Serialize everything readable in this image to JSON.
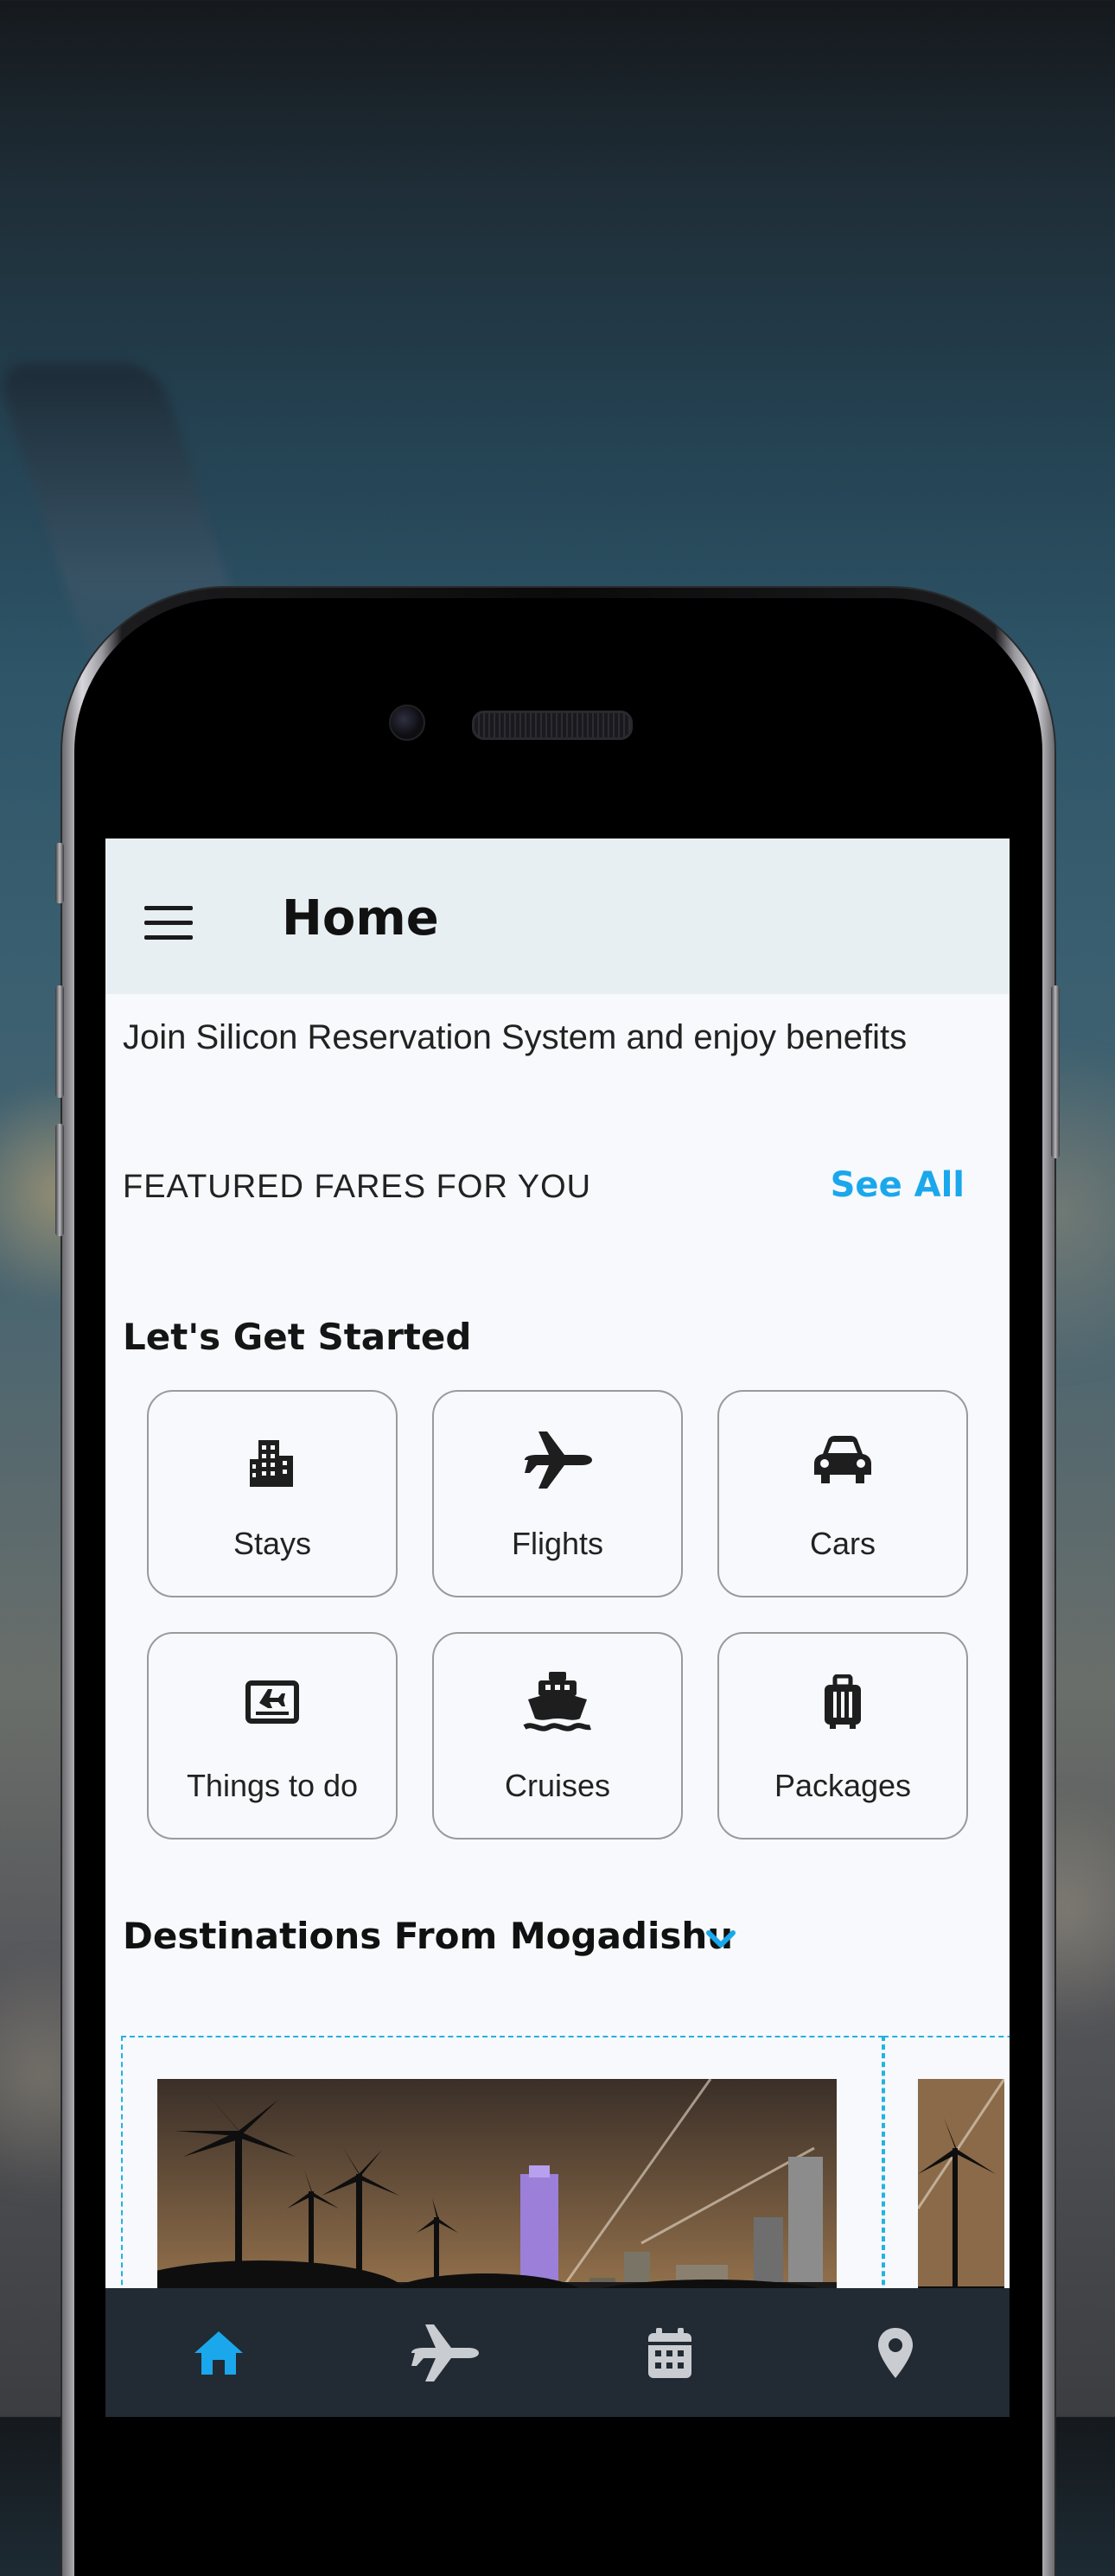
{
  "app": {
    "title": "Home"
  },
  "promo": {
    "text": "Join Silicon Reservation System and enjoy benefits"
  },
  "featured": {
    "title": "FEATURED FARES FOR YOU",
    "see_all": "See All"
  },
  "get_started": {
    "title": "Let's Get Started",
    "tiles": [
      {
        "label": "Stays",
        "icon": "building-icon"
      },
      {
        "label": "Flights",
        "icon": "airplane-icon"
      },
      {
        "label": "Cars",
        "icon": "car-icon"
      },
      {
        "label": "Things to do",
        "icon": "ticket-icon"
      },
      {
        "label": "Cruises",
        "icon": "ship-icon"
      },
      {
        "label": "Packages",
        "icon": "luggage-icon"
      }
    ]
  },
  "destinations": {
    "title": "Destinations From Mogadishu",
    "accent_color": "#1aa7ec"
  },
  "bottom_nav": {
    "items": [
      {
        "icon": "home-icon",
        "active": true
      },
      {
        "icon": "airplane-icon",
        "active": false
      },
      {
        "icon": "calendar-icon",
        "active": false
      },
      {
        "icon": "location-pin-icon",
        "active": false
      }
    ],
    "active_color": "#1aa7ec",
    "inactive_color": "#c9ccd0"
  }
}
